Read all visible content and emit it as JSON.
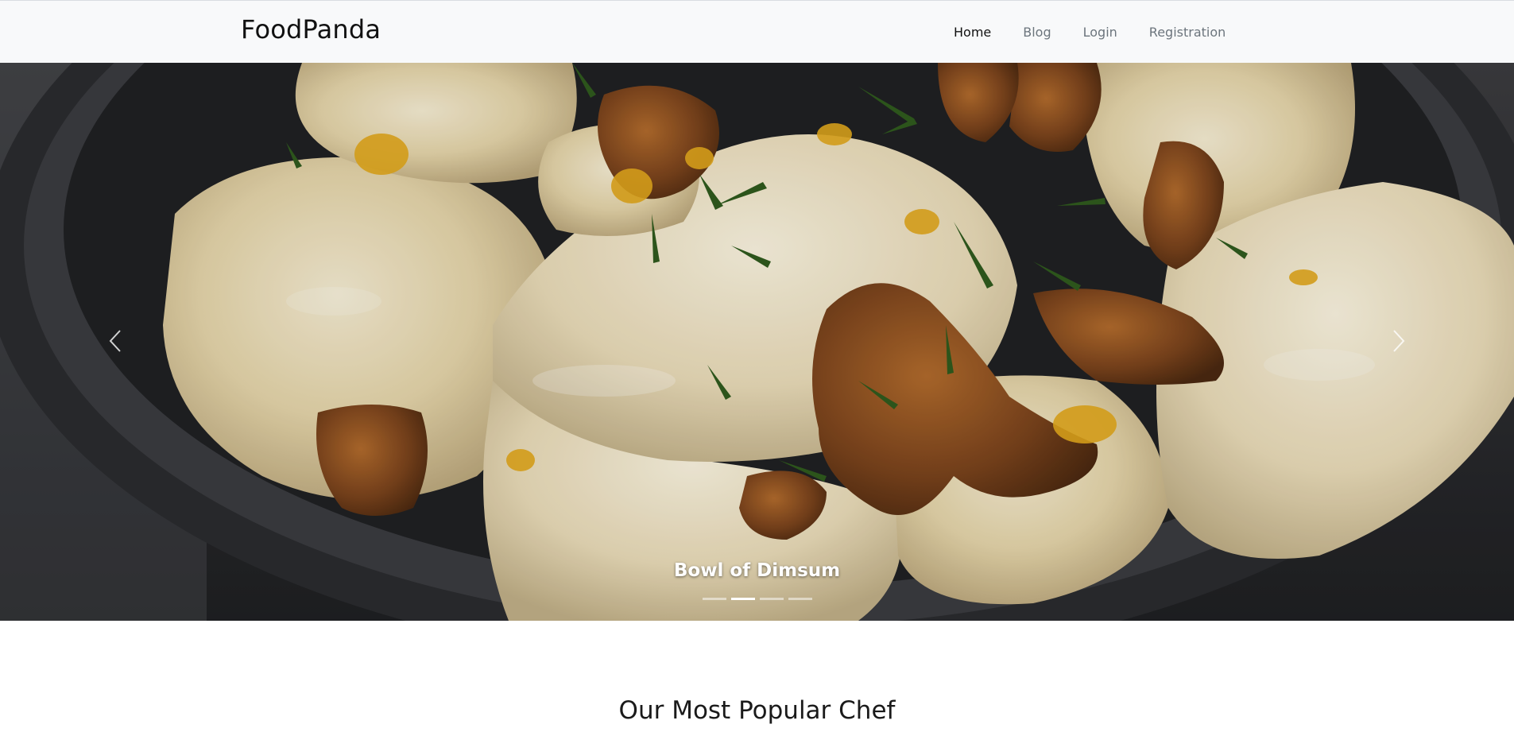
{
  "navbar": {
    "brand": "FoodPanda",
    "links": [
      {
        "label": "Home",
        "active": true
      },
      {
        "label": "Blog",
        "active": false
      },
      {
        "label": "Login",
        "active": false
      },
      {
        "label": "Registration",
        "active": false
      }
    ]
  },
  "carousel": {
    "caption": "Bowl of Dimsum",
    "indicator_count": 4,
    "active_indicator": 2,
    "prev_icon": "chevron-left-icon",
    "next_icon": "chevron-right-icon"
  },
  "section": {
    "title": "Our Most Popular Chef"
  },
  "colors": {
    "navbar_bg": "#f8f9fa",
    "nav_link": "#6c757d",
    "nav_link_active": "#111111",
    "caption": "#ffffff"
  }
}
